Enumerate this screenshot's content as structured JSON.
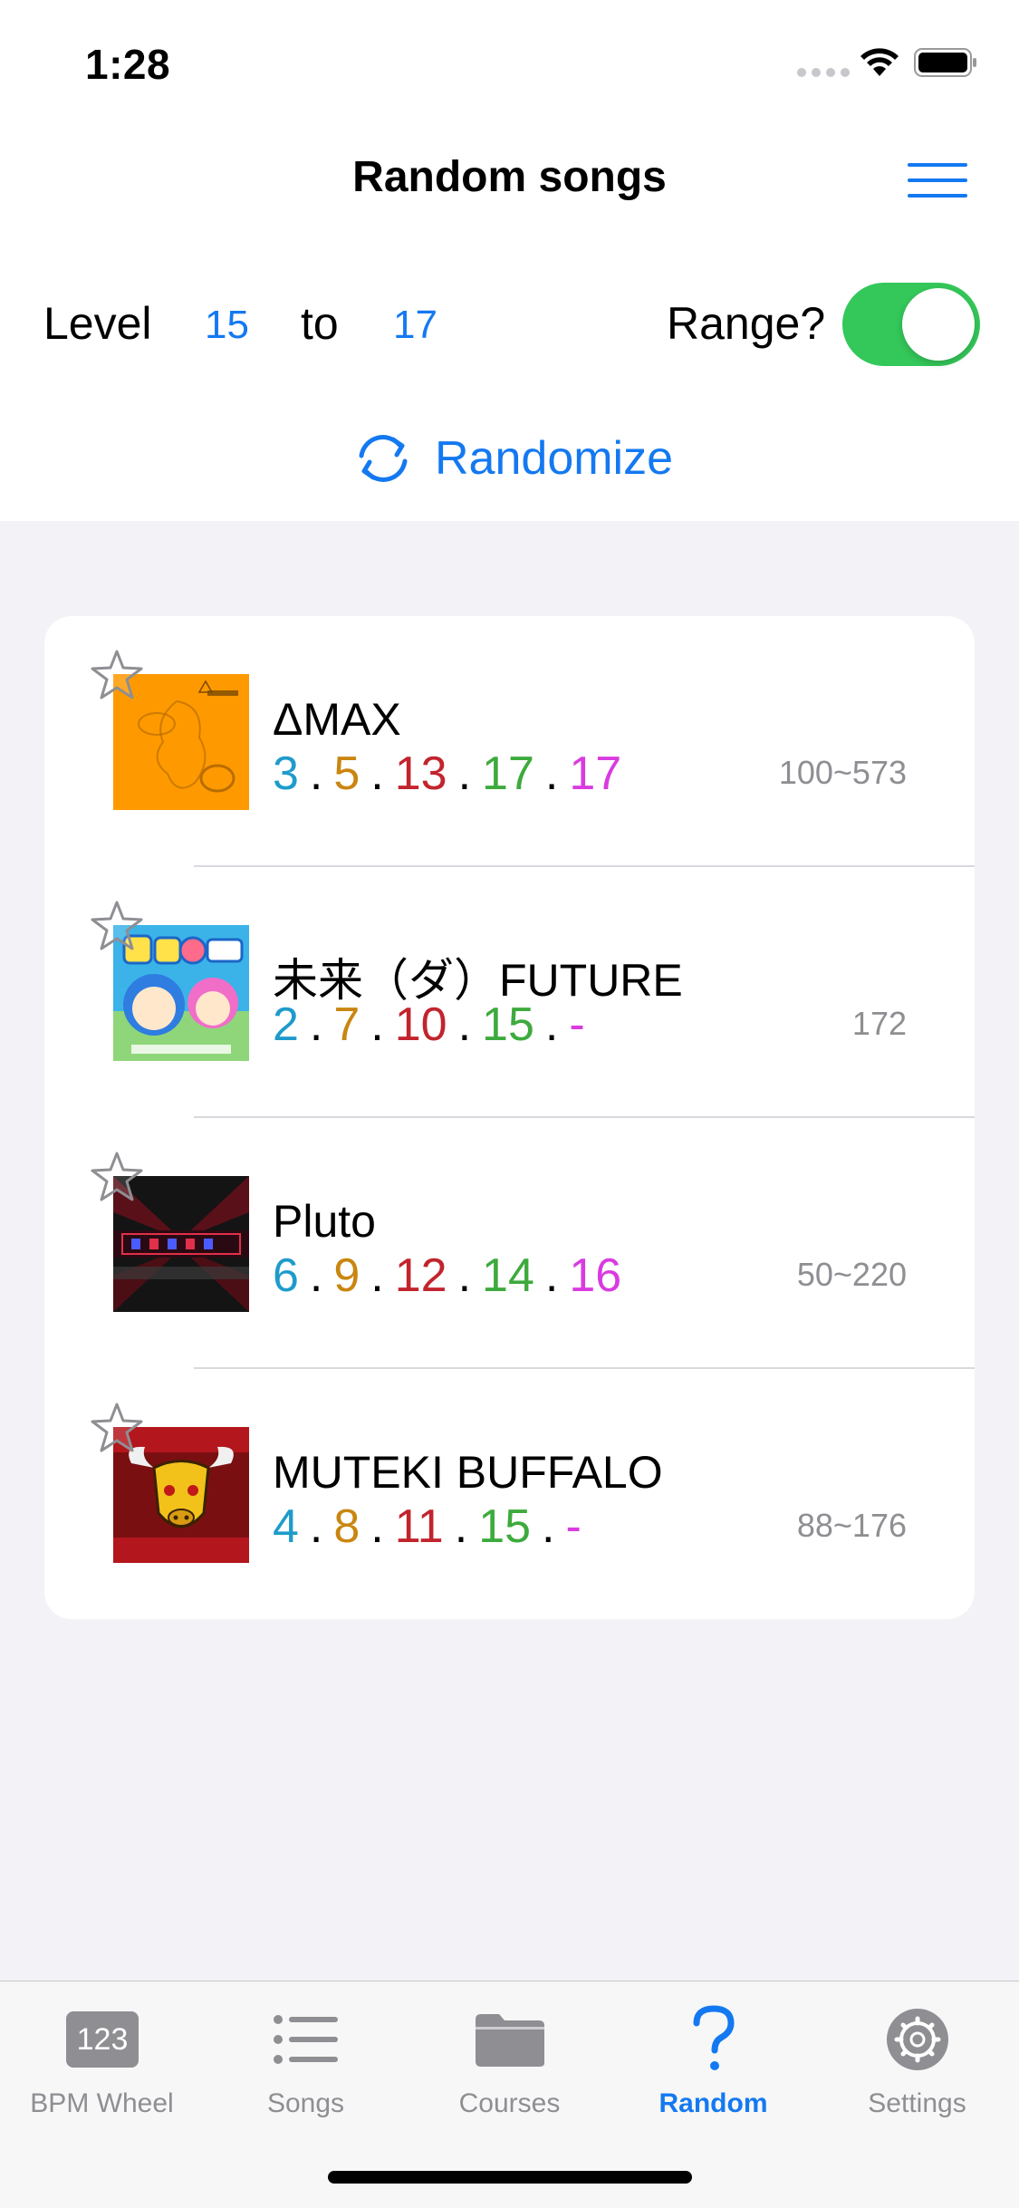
{
  "status_bar": {
    "time": "1:28"
  },
  "header": {
    "title": "Random songs",
    "menu_icon": "hamburger-menu-icon"
  },
  "filters": {
    "level_label": "Level",
    "level_from": "15",
    "to_label": "to",
    "level_to": "17",
    "range_label": "Range?",
    "range_enabled": true
  },
  "randomize": {
    "label": "Randomize",
    "icon": "refresh-icon"
  },
  "colors": {
    "accent": "#1479F1",
    "toggle_on": "#34C759",
    "level_beginner": "#1E9BCB",
    "level_basic": "#C98610",
    "level_difficult": "#C2242D",
    "level_expert": "#3DAA3D",
    "level_challenge": "#D93BE0"
  },
  "songs": [
    {
      "title": "ΔMAX",
      "levels": [
        "3",
        "5",
        "13",
        "17",
        "17"
      ],
      "bpm": "100~573",
      "favorite_icon": "star-outline-icon"
    },
    {
      "title": "未来（ダ）FUTURE",
      "levels": [
        "2",
        "7",
        "10",
        "15",
        "-"
      ],
      "bpm": "172",
      "favorite_icon": "star-outline-icon"
    },
    {
      "title": "Pluto",
      "levels": [
        "6",
        "9",
        "12",
        "14",
        "16"
      ],
      "bpm": "50~220",
      "favorite_icon": "star-outline-icon"
    },
    {
      "title": "MUTEKI BUFFALO",
      "levels": [
        "4",
        "8",
        "11",
        "15",
        "-"
      ],
      "bpm": "88~176",
      "favorite_icon": "star-outline-icon"
    }
  ],
  "tabs": [
    {
      "label": "BPM Wheel",
      "icon": "bpm-wheel-icon",
      "active": false
    },
    {
      "label": "Songs",
      "icon": "list-icon",
      "active": false
    },
    {
      "label": "Courses",
      "icon": "folder-icon",
      "active": false
    },
    {
      "label": "Random",
      "icon": "question-mark-icon",
      "active": true
    },
    {
      "label": "Settings",
      "icon": "gear-icon",
      "active": false
    }
  ]
}
